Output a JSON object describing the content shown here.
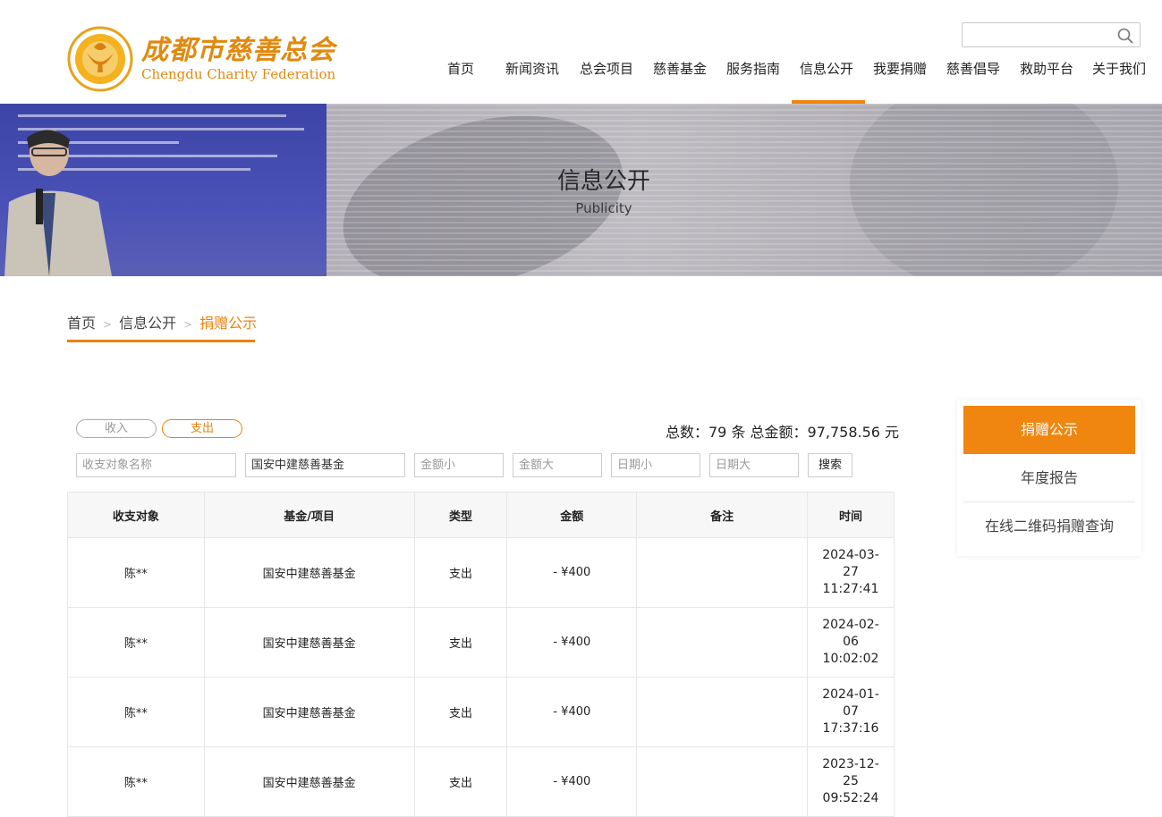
{
  "header": {
    "logo_cn": "成都市慈善总会",
    "logo_en": "Chengdu Charity Federation",
    "search_placeholder": "",
    "nav": [
      "首页",
      "新闻资讯",
      "总会项目",
      "慈善基金",
      "服务指南",
      "信息公开",
      "我要捐赠",
      "慈善倡导",
      "救助平台",
      "关于我们"
    ],
    "active_nav": "信息公开"
  },
  "banner": {
    "title": "信息公开",
    "subtitle": "Publicity"
  },
  "breadcrumb": {
    "home": "首页",
    "level1": "信息公开",
    "current": "捐赠公示"
  },
  "filters": {
    "toggle_in": "收入",
    "toggle_out": "支出",
    "selected_toggle": "支出",
    "summary": "总数：79 条  总金额：97,758.56 元",
    "name_placeholder": "收支对象名称",
    "fund_value": "国安中建慈善基金",
    "min_amount_placeholder": "金额小",
    "max_amount_placeholder": "金额大",
    "min_date_placeholder": "日期小",
    "max_date_placeholder": "日期大",
    "search_button": "搜索"
  },
  "table": {
    "headers": [
      "收支对象",
      "基金/项目",
      "类型",
      "金额",
      "备注",
      "时间"
    ],
    "rows": [
      {
        "target": "陈**",
        "fund": "国安中建慈善基金",
        "type": "支出",
        "amount": "- ¥400",
        "note": "",
        "time1": "2024-03-",
        "time2": "27",
        "time3": "11:27:41"
      },
      {
        "target": "陈**",
        "fund": "国安中建慈善基金",
        "type": "支出",
        "amount": "- ¥400",
        "note": "",
        "time1": "2024-02-",
        "time2": "06",
        "time3": "10:02:02"
      },
      {
        "target": "陈**",
        "fund": "国安中建慈善基金",
        "type": "支出",
        "amount": "- ¥400",
        "note": "",
        "time1": "2024-01-",
        "time2": "07",
        "time3": "17:37:16"
      },
      {
        "target": "陈**",
        "fund": "国安中建慈善基金",
        "type": "支出",
        "amount": "- ¥400",
        "note": "",
        "time1": "2023-12-",
        "time2": "25",
        "time3": "09:52:24"
      }
    ]
  },
  "side_menu": {
    "active": "捐赠公示",
    "item2": "年度报告",
    "item3": "在线二维码捐赠查询"
  },
  "colors": {
    "accent": "#f0860f",
    "amount": "#3bb0a0"
  }
}
